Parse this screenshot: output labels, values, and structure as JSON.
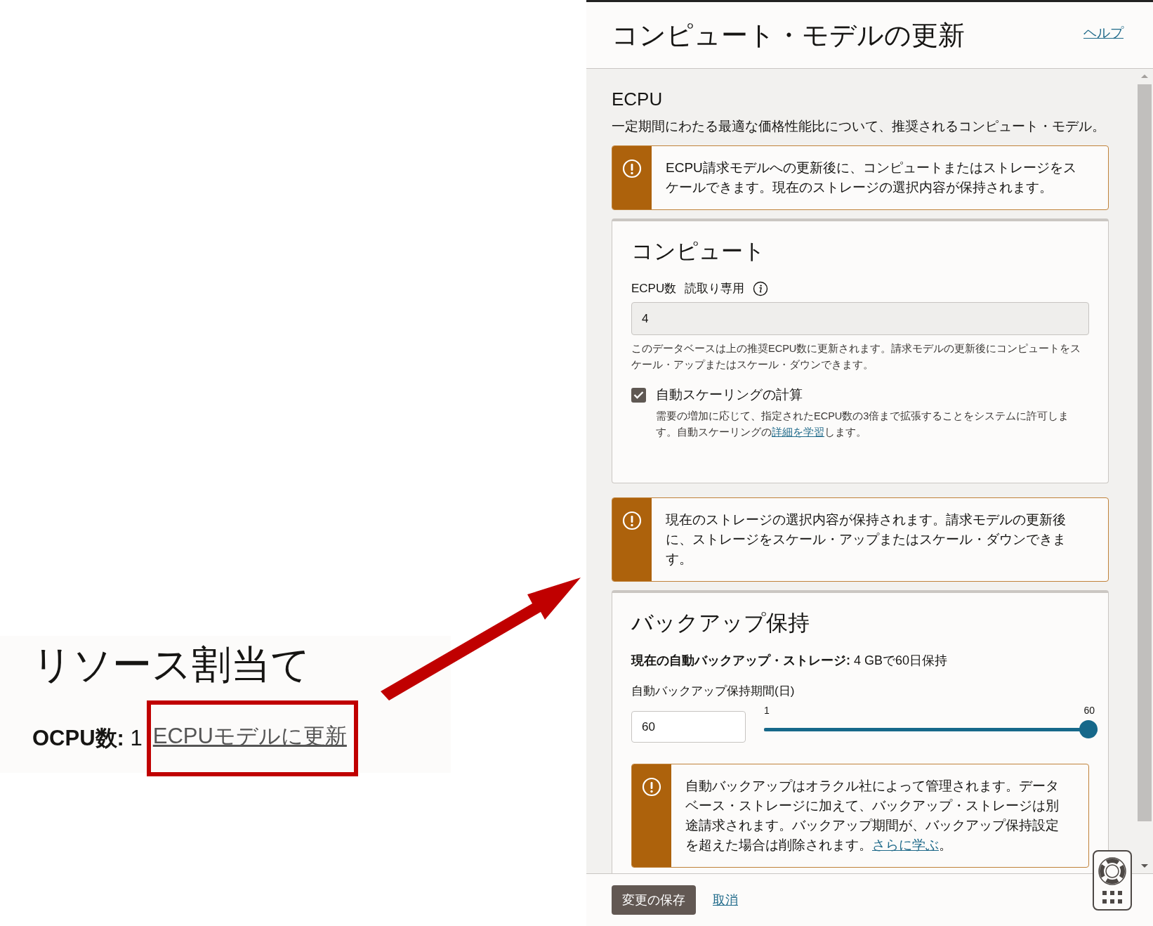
{
  "annotation": {
    "heading": "リソース割当て",
    "ocpu_line": "**OCPU数:** 1",
    "link": "ECPUモデルに更新"
  },
  "panel": {
    "title": "コンピュート・モデルの更新",
    "help_link": "ヘルプ",
    "section": {
      "title": "ECPU",
      "description": "一定期間にわたる最適な価格性能比について、推奨されるコンピュート・モデル。"
    },
    "notice_top": {
      "kind": "warning",
      "text": "ECPU請求モデルへの更新後に、コンピュートまたはストレージをスケールできます。現在のストレージの選択内容が保持されます。"
    },
    "compute": {
      "title": "コンピュート",
      "field_label": "ECPU数",
      "field_badge": "読取り専用",
      "field_value": "4",
      "field_help": "このデータベースは上の推奨ECPU数に更新されます。請求モデルの更新後にコンピュートをスケール・アップまたはスケール・ダウンできます。",
      "checkbox": {
        "label": "自動スケーリングの計算",
        "checked": true,
        "text_before": "需要の増加に応じて、指定されたECPU数の3倍まで拡張することをシステムに許可します。自動スケーリングの",
        "link": "詳細を学習",
        "text_after": "します。"
      }
    },
    "notice_middle": {
      "kind": "warning",
      "text": "現在のストレージの選択内容が保持されます。請求モデルの更新後に、ストレージをスケール・アップまたはスケール・ダウンできます。"
    },
    "backup": {
      "title": "バックアップ保持",
      "storage_line": "**現在の自動バックアップ・ストレージ:** 4 GBで60日保持",
      "field_label": "自動バックアップ保持期間(日)",
      "field_value": "60",
      "slider": {
        "min_label": "1",
        "max_label": "60",
        "level": 1
      },
      "notice": {
        "kind": "warning",
        "text_before": "自動バックアップはオラクル社によって管理されます。データベース・ストレージに加えて、バックアップ・ストレージは別途請求されます。バックアップ期間が、バックアップ保持設定を超えた場合は削除されます。",
        "link": "さらに学ぶ",
        "text_after": "。"
      }
    },
    "footer": {
      "save": "変更の保存",
      "cancel": "取消"
    }
  }
}
